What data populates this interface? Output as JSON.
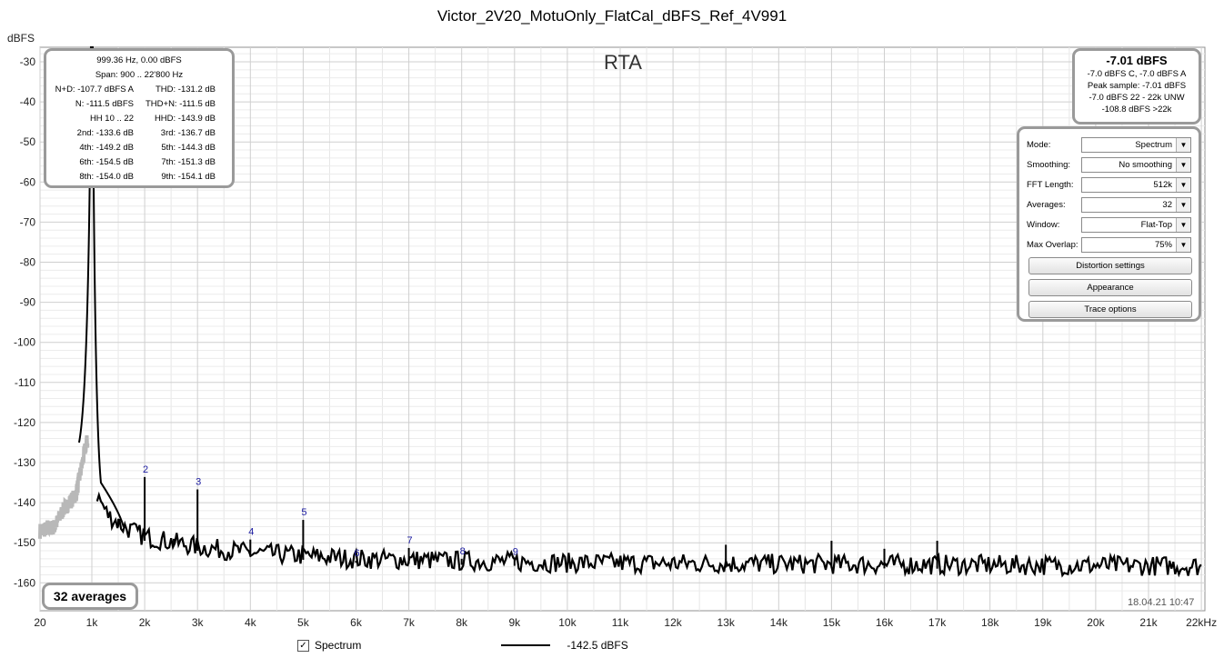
{
  "title": "Victor_2V20_MotuOnly_FlatCal_dBFS_Ref_4V991",
  "rta_label": "RTA",
  "y_unit": "dBFS",
  "info": {
    "fund": "999.36 Hz, 0.00 dBFS",
    "span": "Span: 900 .. 22'800 Hz",
    "rows": [
      [
        "N+D: -107.7 dBFS A",
        "THD: -131.2 dB"
      ],
      [
        "N: -111.5 dBFS",
        "THD+N: -111.5 dB"
      ],
      [
        "HH 10 .. 22",
        "HHD: -143.9 dB"
      ],
      [
        "2nd: -133.6 dB",
        "3rd: -136.7 dB"
      ],
      [
        "4th: -149.2 dB",
        "5th: -144.3 dB"
      ],
      [
        "6th: -154.5 dB",
        "7th: -151.3 dB"
      ],
      [
        "8th: -154.0 dB",
        "9th: -154.1 dB"
      ]
    ]
  },
  "level": {
    "main": "-7.01 dBFS",
    "lines": [
      "-7.0 dBFS C, -7.0 dBFS A",
      "Peak sample: -7.01 dBFS",
      "-7.0 dBFS 22 - 22k UNW",
      "-108.8 dBFS >22k"
    ]
  },
  "controls": [
    {
      "label": "Mode:",
      "value": "Spectrum"
    },
    {
      "label": "Smoothing:",
      "value": "No  smoothing"
    },
    {
      "label": "FFT Length:",
      "value": "512k"
    },
    {
      "label": "Averages:",
      "value": "32"
    },
    {
      "label": "Window:",
      "value": "Flat-Top"
    },
    {
      "label": "Max Overlap:",
      "value": "75%"
    }
  ],
  "buttons": {
    "distortion": "Distortion settings",
    "appearance": "Appearance",
    "trace": "Trace options"
  },
  "averages_badge": "32 averages",
  "timestamp": "18.04.21 10:47",
  "legend": {
    "checkbox_mark": "✓",
    "series_name": "Spectrum",
    "value": "-142.5 dBFS"
  },
  "chart_data": {
    "type": "line",
    "xlabel": "",
    "ylabel": "dBFS",
    "xlim": [
      20,
      22000
    ],
    "ylim": [
      -163,
      -28
    ],
    "x_ticks": [
      20,
      1000,
      2000,
      3000,
      4000,
      5000,
      6000,
      7000,
      8000,
      9000,
      10000,
      11000,
      12000,
      13000,
      14000,
      15000,
      16000,
      17000,
      18000,
      19000,
      20000,
      21000,
      22000
    ],
    "x_tick_labels": [
      "20",
      "1k",
      "2k",
      "3k",
      "4k",
      "5k",
      "6k",
      "7k",
      "8k",
      "9k",
      "10k",
      "11k",
      "12k",
      "13k",
      "14k",
      "15k",
      "16k",
      "17k",
      "18k",
      "19k",
      "20k",
      "21k",
      "22kHz"
    ],
    "y_ticks": [
      -30,
      -40,
      -50,
      -60,
      -70,
      -80,
      -90,
      -100,
      -110,
      -120,
      -130,
      -140,
      -150,
      -160
    ],
    "grid": true,
    "fundamental": {
      "x": 999.36,
      "y": 0
    },
    "harmonics": [
      {
        "label": "2",
        "x": 2000,
        "y": -133.6
      },
      {
        "label": "3",
        "x": 3000,
        "y": -136.7
      },
      {
        "label": "4",
        "x": 4000,
        "y": -149.2
      },
      {
        "label": "5",
        "x": 5000,
        "y": -144.3
      },
      {
        "label": "6",
        "x": 6000,
        "y": -154.5
      },
      {
        "label": "7",
        "x": 7000,
        "y": -151.3
      },
      {
        "label": "8",
        "x": 8000,
        "y": -154.0
      },
      {
        "label": "9",
        "x": 9000,
        "y": -154.1
      }
    ],
    "spurs": [
      {
        "x": 2550,
        "y": -149
      },
      {
        "x": 13000,
        "y": -150.5
      },
      {
        "x": 15000,
        "y": -149.5
      },
      {
        "x": 16000,
        "y": -151.5
      },
      {
        "x": 17000,
        "y": -149.5
      },
      {
        "x": 1500,
        "y": -144
      }
    ],
    "noise_floor": [
      {
        "x": 1100,
        "y": -138
      },
      {
        "x": 1300,
        "y": -143
      },
      {
        "x": 1600,
        "y": -146
      },
      {
        "x": 2000,
        "y": -148.5
      },
      {
        "x": 3000,
        "y": -151
      },
      {
        "x": 4000,
        "y": -152.5
      },
      {
        "x": 6000,
        "y": -154
      },
      {
        "x": 10000,
        "y": -155
      },
      {
        "x": 22000,
        "y": -155.8
      }
    ],
    "low_band": [
      {
        "x": 20,
        "y": -147
      },
      {
        "x": 300,
        "y": -146
      },
      {
        "x": 450,
        "y": -142
      },
      {
        "x": 700,
        "y": -138
      },
      {
        "x": 900,
        "y": -125
      }
    ]
  }
}
